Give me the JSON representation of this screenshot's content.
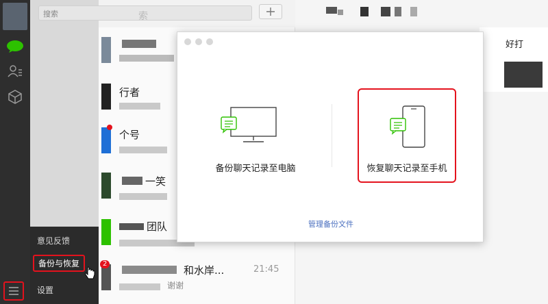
{
  "search": {
    "placeholder": "搜索",
    "placeholder_faint": "索"
  },
  "toolbar": {
    "add_icon": "plus-icon"
  },
  "chat_list": [
    {
      "name": "",
      "preview": ""
    },
    {
      "name": "行者",
      "preview": ""
    },
    {
      "name": "个号",
      "preview": ""
    },
    {
      "name": "一笑",
      "preview": ""
    },
    {
      "name": "团队",
      "preview": ""
    },
    {
      "name": "和水岸...",
      "time": "21:45",
      "preview": "谢谢",
      "badge": "2"
    }
  ],
  "right_header": {
    "partial": "好打"
  },
  "side_menu": {
    "items": [
      {
        "label": "意见反馈"
      },
      {
        "label": "备份与恢复"
      },
      {
        "label": "设置"
      }
    ]
  },
  "dialog": {
    "backup_label": "备份聊天记录至电脑",
    "restore_label": "恢复聊天记录至手机",
    "manage_label": "管理备份文件"
  },
  "colors": {
    "accent_red": "#e4121d",
    "link_blue": "#4a6fbf",
    "wechat_green": "#2dc100"
  }
}
